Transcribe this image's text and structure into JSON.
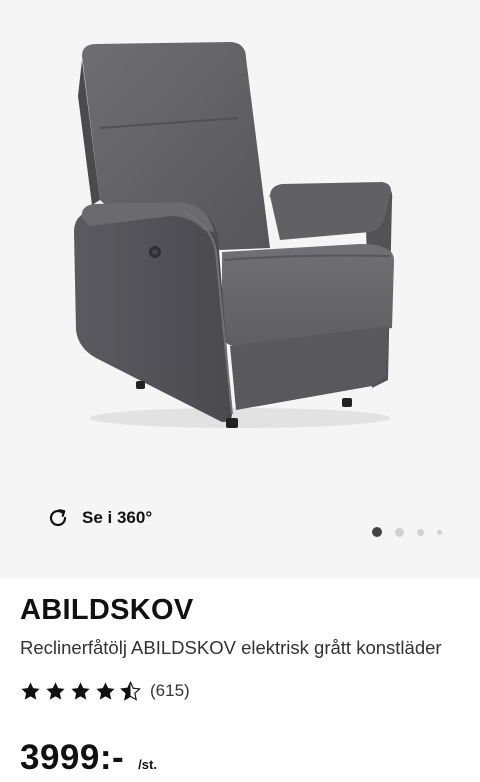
{
  "gallery": {
    "view360_label": "Se i 360°",
    "current_slide": 1,
    "slide_count": 4
  },
  "product": {
    "brand": "ABILDSKOV",
    "description": "Reclinerfåtölj ABILDSKOV elektrisk grått konstläder",
    "rating": 4.5,
    "max_rating": 5,
    "reviews": "(615)",
    "price": "3999:-",
    "unit": "/st."
  },
  "icons": {
    "view360": "rotate-icon",
    "star": "star-icon"
  },
  "colors": {
    "gallery_background": "#f5f5f5",
    "text": "#111111",
    "active_dot": "#444444",
    "inactive_dot": "#d0d0d0"
  }
}
